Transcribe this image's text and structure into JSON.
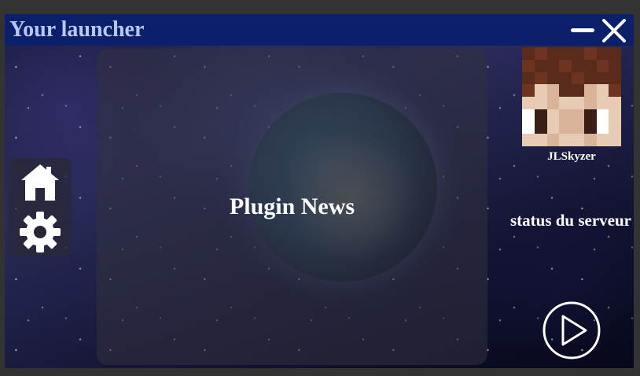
{
  "app": {
    "title": "Your launcher"
  },
  "window_controls": {
    "minimize_icon": "minimize-icon",
    "close_icon": "close-icon"
  },
  "news": {
    "title": "Plugin News"
  },
  "side_menu": {
    "items": [
      {
        "icon": "home-icon"
      },
      {
        "icon": "gear-icon"
      }
    ]
  },
  "profile": {
    "username": "JLSkyzer"
  },
  "server": {
    "status_text": "status du serveur"
  },
  "play": {
    "icon": "play-icon"
  },
  "colors": {
    "titlebar": "#0b1f6b",
    "title_text": "#b8c8f4",
    "icon": "#ffffff"
  }
}
